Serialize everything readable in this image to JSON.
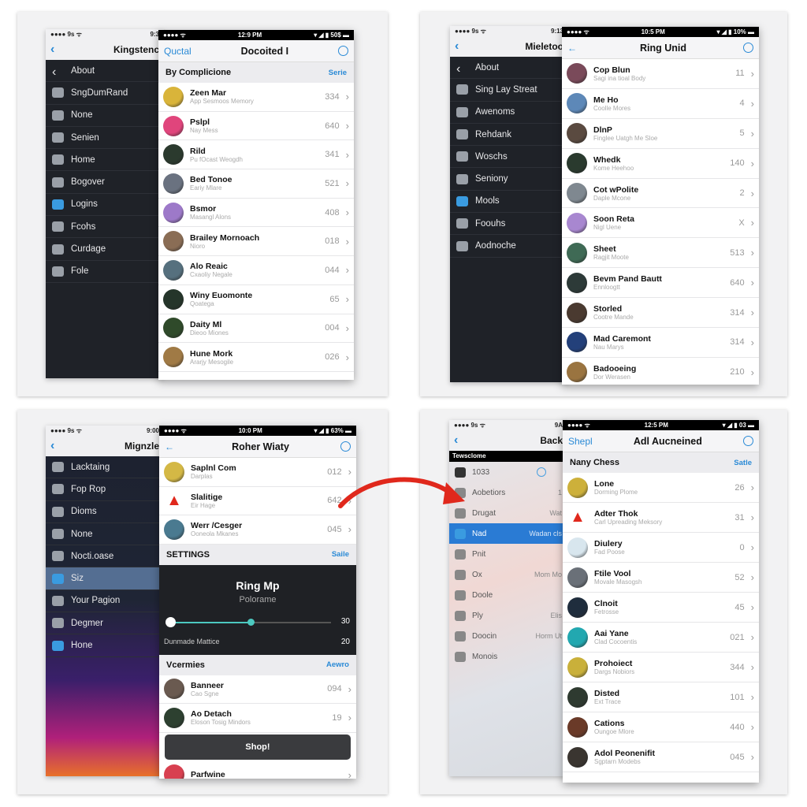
{
  "accent_color": "#2a8ad6",
  "arrow_color": "#e0281c",
  "panels": [
    {
      "back": {
        "status": "●●●● 9s ᯤ",
        "time": "9:3",
        "title": "Kingstenc",
        "items": [
          {
            "label": "About",
            "icon": "chevron-left-icon"
          },
          {
            "label": "SngDumRand",
            "icon": "list-icon"
          },
          {
            "label": "None",
            "icon": "image-icon"
          },
          {
            "label": "Senien",
            "icon": "person-walking-icon"
          },
          {
            "label": "Home",
            "icon": "camera-icon"
          },
          {
            "label": "Bogover",
            "icon": "disc-icon"
          },
          {
            "label": "Logins",
            "icon": "mail-icon"
          },
          {
            "label": "Fcohs",
            "icon": "heart-icon"
          },
          {
            "label": "Curdage",
            "icon": "lightbulb-icon"
          },
          {
            "label": "Fole",
            "icon": "x-box-icon"
          }
        ]
      },
      "front": {
        "status_left": "●●●● ᯤ",
        "time": "12:9 PM",
        "status_right": "▾ ◢ ▮ 50$ ▬",
        "nav_left": "Quctal",
        "title": "Docoited I",
        "blocks": [
          {
            "type": "section",
            "title": "By Complicione",
            "action": "Serie"
          },
          {
            "type": "rows",
            "items": [
              {
                "name": "Zeen Mar",
                "sub": "App Sesmoos Memory",
                "count": "334",
                "color": "#d9b43a"
              },
              {
                "name": "Pslpl",
                "sub": "Nay Mess",
                "count": "640",
                "color": "#e0457c"
              },
              {
                "name": "Rild",
                "sub": "Pu fOcast Weogdh",
                "count": "341",
                "color": "#2b3a2e"
              },
              {
                "name": "Bed Tonoe",
                "sub": "Eariy Mlare",
                "count": "521",
                "color": "#6a7280"
              },
              {
                "name": "Bsmor",
                "sub": "Masangl Alons",
                "count": "408",
                "color": "#9d79c9"
              },
              {
                "name": "Brailey Mornoach",
                "sub": "Nioro",
                "count": "018",
                "color": "#8a6d55"
              },
              {
                "name": "Alo Reaic",
                "sub": "Cxaoliy Negale",
                "count": "044",
                "color": "#56707e"
              },
              {
                "name": "Winy Euomonte",
                "sub": "Qoatega",
                "count": "65",
                "color": "#25352a"
              },
              {
                "name": "Daity Ml",
                "sub": "Dieoo Miones",
                "count": "004",
                "color": "#2f4a2a"
              },
              {
                "name": "Hune Mork",
                "sub": "Ararjy Mesogile",
                "count": "026",
                "color": "#a07a45"
              }
            ]
          }
        ]
      }
    },
    {
      "back": {
        "status": "●●●● 9s ᯤ",
        "time": "9:13",
        "title": "Mieletoo",
        "items": [
          {
            "label": "About",
            "icon": "chevron-left-icon"
          },
          {
            "label": "Sing Lay Streat",
            "icon": "phone-icon"
          },
          {
            "label": "Awenoms",
            "icon": "calendar-icon"
          },
          {
            "label": "Rehdank",
            "icon": "building-icon"
          },
          {
            "label": "Woschs",
            "icon": "disc-icon"
          },
          {
            "label": "Seniony",
            "icon": "gift-icon"
          },
          {
            "label": "Mools",
            "icon": "mail-icon"
          },
          {
            "label": "Foouhs",
            "icon": "heart-icon"
          },
          {
            "label": "Aodnoche",
            "icon": "x-box-icon"
          }
        ]
      },
      "front": {
        "status_left": "●●●● ᯤ",
        "time": "10:5 PM",
        "status_right": "▾ ◢ ▮ 10% ▬",
        "nav_left": "←",
        "title": "Ring Unid",
        "blocks": [
          {
            "type": "rows",
            "items": [
              {
                "name": "Cop Blun",
                "sub": "Sagi ina tioal Body",
                "count": "11",
                "color": "#7a4a5a"
              },
              {
                "name": "Me Ho",
                "sub": "Coolle Mores",
                "count": "4",
                "color": "#5d88b8"
              },
              {
                "name": "DlnP",
                "sub": "Finglee Uatgh Me Sloe",
                "count": "5",
                "color": "#5a4a40"
              },
              {
                "name": "Whedk",
                "sub": "Kome Heehoo",
                "count": "140",
                "color": "#2a3a2e"
              },
              {
                "name": "Cot wPolite",
                "sub": "Daple Mcone",
                "count": "2",
                "color": "#7f8890"
              },
              {
                "name": "Soon Reta",
                "sub": "Nigl Uene",
                "count": "X",
                "color": "#a887d0"
              },
              {
                "name": "Sheet",
                "sub": "Ragjit Moote",
                "count": "513",
                "color": "#3f6a55"
              },
              {
                "name": "Bevm Pand Bautt",
                "sub": "Ennloogtt",
                "count": "640",
                "color": "#2d3a38"
              },
              {
                "name": "Storled",
                "sub": "Cootre Mande",
                "count": "314",
                "color": "#4a3a30"
              },
              {
                "name": "Mad Caremont",
                "sub": "Nau Marys",
                "count": "314",
                "color": "#23407a"
              },
              {
                "name": "Badooeing",
                "sub": "Dor Werasen",
                "count": "210",
                "color": "#9a7440"
              }
            ]
          }
        ]
      }
    },
    {
      "back": {
        "status": "●●●● 9s ᯤ",
        "time": "9:00",
        "title": "Mignzle",
        "items": [
          {
            "label": "Lacktaing",
            "icon": "scissors-icon"
          },
          {
            "label": "Fop Rop",
            "icon": "compass-icon"
          },
          {
            "label": "Dioms",
            "icon": "tree-icon"
          },
          {
            "label": "None",
            "icon": "camera-icon"
          },
          {
            "label": "Nocti.oase",
            "icon": "calendar-icon"
          },
          {
            "label": "Siz",
            "icon": "bag-icon",
            "selected": true
          },
          {
            "label": "Your Pagion",
            "icon": "badge-icon"
          },
          {
            "label": "Degmer",
            "icon": "note-icon"
          },
          {
            "label": "Hone",
            "icon": "home-icon"
          }
        ]
      },
      "front": {
        "status_left": "●●●● ᯤ",
        "time": "10:0 PM",
        "status_right": "▾ ◢ ▮ 63% ▬",
        "nav_left": "←",
        "title": "Roher Wiaty",
        "blocks": [
          {
            "type": "rows",
            "items": [
              {
                "name": "Saplnl Com",
                "sub": "Darplas",
                "count": "012",
                "color": "#d4b845"
              },
              {
                "name": "Slalitige",
                "sub": "Eir Hage",
                "count": "642",
                "color": "#ffffff",
                "warning": true
              },
              {
                "name": "Werr /Cesger",
                "sub": "Ooneola Mkanes",
                "count": "045",
                "color": "#4a7a90"
              }
            ]
          },
          {
            "type": "section",
            "title": "SETTINGS",
            "action": "Saile"
          },
          {
            "type": "panel",
            "title": "Ring Mp",
            "subtitle": "Polorame",
            "slider_value": 30,
            "slider_max": 60,
            "value_label": "30",
            "label": "Dunmade Mattice",
            "label_value": "20"
          },
          {
            "type": "section",
            "title": "Vcermies",
            "action": "Aewro"
          },
          {
            "type": "rows",
            "items": [
              {
                "name": "Banneer",
                "sub": "Cao Sgne",
                "count": "094",
                "color": "#6a5a50"
              },
              {
                "name": "Ao Detach",
                "sub": "Eloson Tosig Mindors",
                "count": "19",
                "color": "#2d4030"
              }
            ]
          },
          {
            "type": "button",
            "label": "Shop!"
          },
          {
            "type": "rows",
            "items": [
              {
                "name": "Parfwine",
                "sub": "",
                "count": "",
                "color": "#d84050"
              }
            ]
          }
        ]
      }
    },
    {
      "back": {
        "status": "●●●● 9s ᯤ",
        "time": "9A",
        "title": "Back",
        "bar": "Tewsclome",
        "tool_value": "1033",
        "items": [
          {
            "label": "Aobetiors",
            "icon": "avatar-icon",
            "extra": "1"
          },
          {
            "label": "Drugat",
            "icon": "avatar-icon",
            "extra": "Wat"
          },
          {
            "label": "Nad",
            "icon": "bag-icon",
            "extra": "Wadan cls",
            "selected": true
          },
          {
            "label": "Pnit",
            "icon": "image-icon"
          },
          {
            "label": "Ox",
            "icon": "bubble-icon",
            "extra": "Mom Mo"
          },
          {
            "label": "Doole",
            "icon": "cup-icon"
          },
          {
            "label": "Ply",
            "icon": "check-box-icon",
            "extra": "Elis"
          },
          {
            "label": "Doocin",
            "icon": "document-icon",
            "extra": "Horm Ut"
          },
          {
            "label": "Monois",
            "icon": "tag-icon"
          }
        ]
      },
      "front": {
        "status_left": "●●●● ᯤ",
        "time": "12:5 PM",
        "status_right": "▾ ◢ ▮ 03 ▬",
        "nav_left": "Shepl",
        "title": "Adl Aucneined",
        "blocks": [
          {
            "type": "section",
            "title": "Nany Chess",
            "action": "Satle"
          },
          {
            "type": "rows",
            "items": [
              {
                "name": "Lone",
                "sub": "Dorming Plome",
                "count": "26",
                "color": "#cdb03a"
              },
              {
                "name": "Adter Thok",
                "sub": "Carl Upreading Meksory",
                "count": "31",
                "color": "#ffffff",
                "warning": true
              },
              {
                "name": "Diulery",
                "sub": "Fad Poose",
                "count": "0",
                "color": "#d8e6ee"
              },
              {
                "name": "Ftile Vool",
                "sub": "Movale Masogsh",
                "count": "52",
                "color": "#6a7078"
              },
              {
                "name": "Clnoit",
                "sub": "Fetrosse",
                "count": "45",
                "color": "#1f2d3d"
              },
              {
                "name": "Aai Yane",
                "sub": "Clad Cocoentis",
                "count": "021",
                "color": "#22a8b0"
              },
              {
                "name": "Prohoiect",
                "sub": "Dargs Nobiors",
                "count": "344",
                "color": "#c9b03a"
              },
              {
                "name": "Disted",
                "sub": "Ext Trace",
                "count": "101",
                "color": "#2e3a30"
              },
              {
                "name": "Cations",
                "sub": "Oungoe Mlore",
                "count": "440",
                "color": "#6a3a28"
              },
              {
                "name": "Adol Peonenifit",
                "sub": "Sgptarn Modebs",
                "count": "045",
                "color": "#3a3530"
              }
            ]
          }
        ]
      }
    }
  ]
}
